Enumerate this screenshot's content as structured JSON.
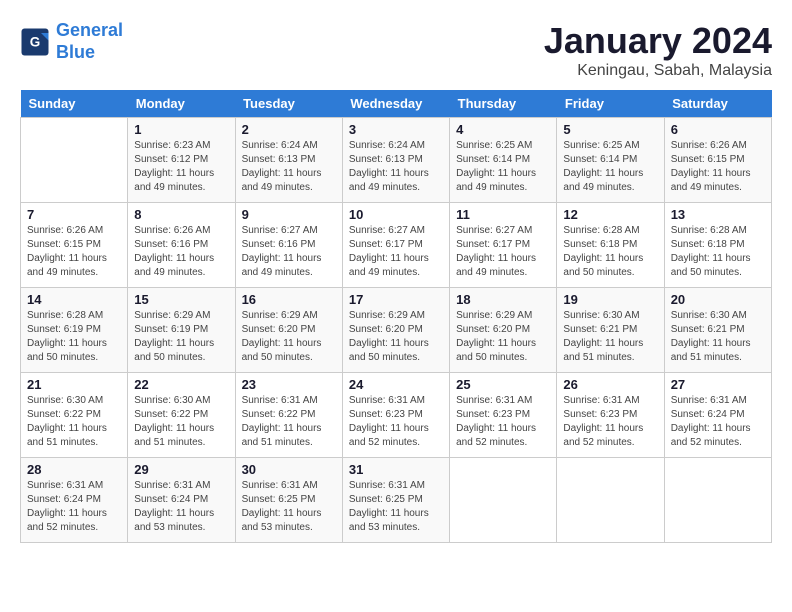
{
  "logo": {
    "text_general": "General",
    "text_blue": "Blue"
  },
  "title": "January 2024",
  "subtitle": "Keningau, Sabah, Malaysia",
  "headers": [
    "Sunday",
    "Monday",
    "Tuesday",
    "Wednesday",
    "Thursday",
    "Friday",
    "Saturday"
  ],
  "weeks": [
    [
      {
        "day": "",
        "sunrise": "",
        "sunset": "",
        "daylight": ""
      },
      {
        "day": "1",
        "sunrise": "Sunrise: 6:23 AM",
        "sunset": "Sunset: 6:12 PM",
        "daylight": "Daylight: 11 hours and 49 minutes."
      },
      {
        "day": "2",
        "sunrise": "Sunrise: 6:24 AM",
        "sunset": "Sunset: 6:13 PM",
        "daylight": "Daylight: 11 hours and 49 minutes."
      },
      {
        "day": "3",
        "sunrise": "Sunrise: 6:24 AM",
        "sunset": "Sunset: 6:13 PM",
        "daylight": "Daylight: 11 hours and 49 minutes."
      },
      {
        "day": "4",
        "sunrise": "Sunrise: 6:25 AM",
        "sunset": "Sunset: 6:14 PM",
        "daylight": "Daylight: 11 hours and 49 minutes."
      },
      {
        "day": "5",
        "sunrise": "Sunrise: 6:25 AM",
        "sunset": "Sunset: 6:14 PM",
        "daylight": "Daylight: 11 hours and 49 minutes."
      },
      {
        "day": "6",
        "sunrise": "Sunrise: 6:26 AM",
        "sunset": "Sunset: 6:15 PM",
        "daylight": "Daylight: 11 hours and 49 minutes."
      }
    ],
    [
      {
        "day": "7",
        "sunrise": "Sunrise: 6:26 AM",
        "sunset": "Sunset: 6:15 PM",
        "daylight": "Daylight: 11 hours and 49 minutes."
      },
      {
        "day": "8",
        "sunrise": "Sunrise: 6:26 AM",
        "sunset": "Sunset: 6:16 PM",
        "daylight": "Daylight: 11 hours and 49 minutes."
      },
      {
        "day": "9",
        "sunrise": "Sunrise: 6:27 AM",
        "sunset": "Sunset: 6:16 PM",
        "daylight": "Daylight: 11 hours and 49 minutes."
      },
      {
        "day": "10",
        "sunrise": "Sunrise: 6:27 AM",
        "sunset": "Sunset: 6:17 PM",
        "daylight": "Daylight: 11 hours and 49 minutes."
      },
      {
        "day": "11",
        "sunrise": "Sunrise: 6:27 AM",
        "sunset": "Sunset: 6:17 PM",
        "daylight": "Daylight: 11 hours and 49 minutes."
      },
      {
        "day": "12",
        "sunrise": "Sunrise: 6:28 AM",
        "sunset": "Sunset: 6:18 PM",
        "daylight": "Daylight: 11 hours and 50 minutes."
      },
      {
        "day": "13",
        "sunrise": "Sunrise: 6:28 AM",
        "sunset": "Sunset: 6:18 PM",
        "daylight": "Daylight: 11 hours and 50 minutes."
      }
    ],
    [
      {
        "day": "14",
        "sunrise": "Sunrise: 6:28 AM",
        "sunset": "Sunset: 6:19 PM",
        "daylight": "Daylight: 11 hours and 50 minutes."
      },
      {
        "day": "15",
        "sunrise": "Sunrise: 6:29 AM",
        "sunset": "Sunset: 6:19 PM",
        "daylight": "Daylight: 11 hours and 50 minutes."
      },
      {
        "day": "16",
        "sunrise": "Sunrise: 6:29 AM",
        "sunset": "Sunset: 6:20 PM",
        "daylight": "Daylight: 11 hours and 50 minutes."
      },
      {
        "day": "17",
        "sunrise": "Sunrise: 6:29 AM",
        "sunset": "Sunset: 6:20 PM",
        "daylight": "Daylight: 11 hours and 50 minutes."
      },
      {
        "day": "18",
        "sunrise": "Sunrise: 6:29 AM",
        "sunset": "Sunset: 6:20 PM",
        "daylight": "Daylight: 11 hours and 50 minutes."
      },
      {
        "day": "19",
        "sunrise": "Sunrise: 6:30 AM",
        "sunset": "Sunset: 6:21 PM",
        "daylight": "Daylight: 11 hours and 51 minutes."
      },
      {
        "day": "20",
        "sunrise": "Sunrise: 6:30 AM",
        "sunset": "Sunset: 6:21 PM",
        "daylight": "Daylight: 11 hours and 51 minutes."
      }
    ],
    [
      {
        "day": "21",
        "sunrise": "Sunrise: 6:30 AM",
        "sunset": "Sunset: 6:22 PM",
        "daylight": "Daylight: 11 hours and 51 minutes."
      },
      {
        "day": "22",
        "sunrise": "Sunrise: 6:30 AM",
        "sunset": "Sunset: 6:22 PM",
        "daylight": "Daylight: 11 hours and 51 minutes."
      },
      {
        "day": "23",
        "sunrise": "Sunrise: 6:31 AM",
        "sunset": "Sunset: 6:22 PM",
        "daylight": "Daylight: 11 hours and 51 minutes."
      },
      {
        "day": "24",
        "sunrise": "Sunrise: 6:31 AM",
        "sunset": "Sunset: 6:23 PM",
        "daylight": "Daylight: 11 hours and 52 minutes."
      },
      {
        "day": "25",
        "sunrise": "Sunrise: 6:31 AM",
        "sunset": "Sunset: 6:23 PM",
        "daylight": "Daylight: 11 hours and 52 minutes."
      },
      {
        "day": "26",
        "sunrise": "Sunrise: 6:31 AM",
        "sunset": "Sunset: 6:23 PM",
        "daylight": "Daylight: 11 hours and 52 minutes."
      },
      {
        "day": "27",
        "sunrise": "Sunrise: 6:31 AM",
        "sunset": "Sunset: 6:24 PM",
        "daylight": "Daylight: 11 hours and 52 minutes."
      }
    ],
    [
      {
        "day": "28",
        "sunrise": "Sunrise: 6:31 AM",
        "sunset": "Sunset: 6:24 PM",
        "daylight": "Daylight: 11 hours and 52 minutes."
      },
      {
        "day": "29",
        "sunrise": "Sunrise: 6:31 AM",
        "sunset": "Sunset: 6:24 PM",
        "daylight": "Daylight: 11 hours and 53 minutes."
      },
      {
        "day": "30",
        "sunrise": "Sunrise: 6:31 AM",
        "sunset": "Sunset: 6:25 PM",
        "daylight": "Daylight: 11 hours and 53 minutes."
      },
      {
        "day": "31",
        "sunrise": "Sunrise: 6:31 AM",
        "sunset": "Sunset: 6:25 PM",
        "daylight": "Daylight: 11 hours and 53 minutes."
      },
      {
        "day": "",
        "sunrise": "",
        "sunset": "",
        "daylight": ""
      },
      {
        "day": "",
        "sunrise": "",
        "sunset": "",
        "daylight": ""
      },
      {
        "day": "",
        "sunrise": "",
        "sunset": "",
        "daylight": ""
      }
    ]
  ]
}
